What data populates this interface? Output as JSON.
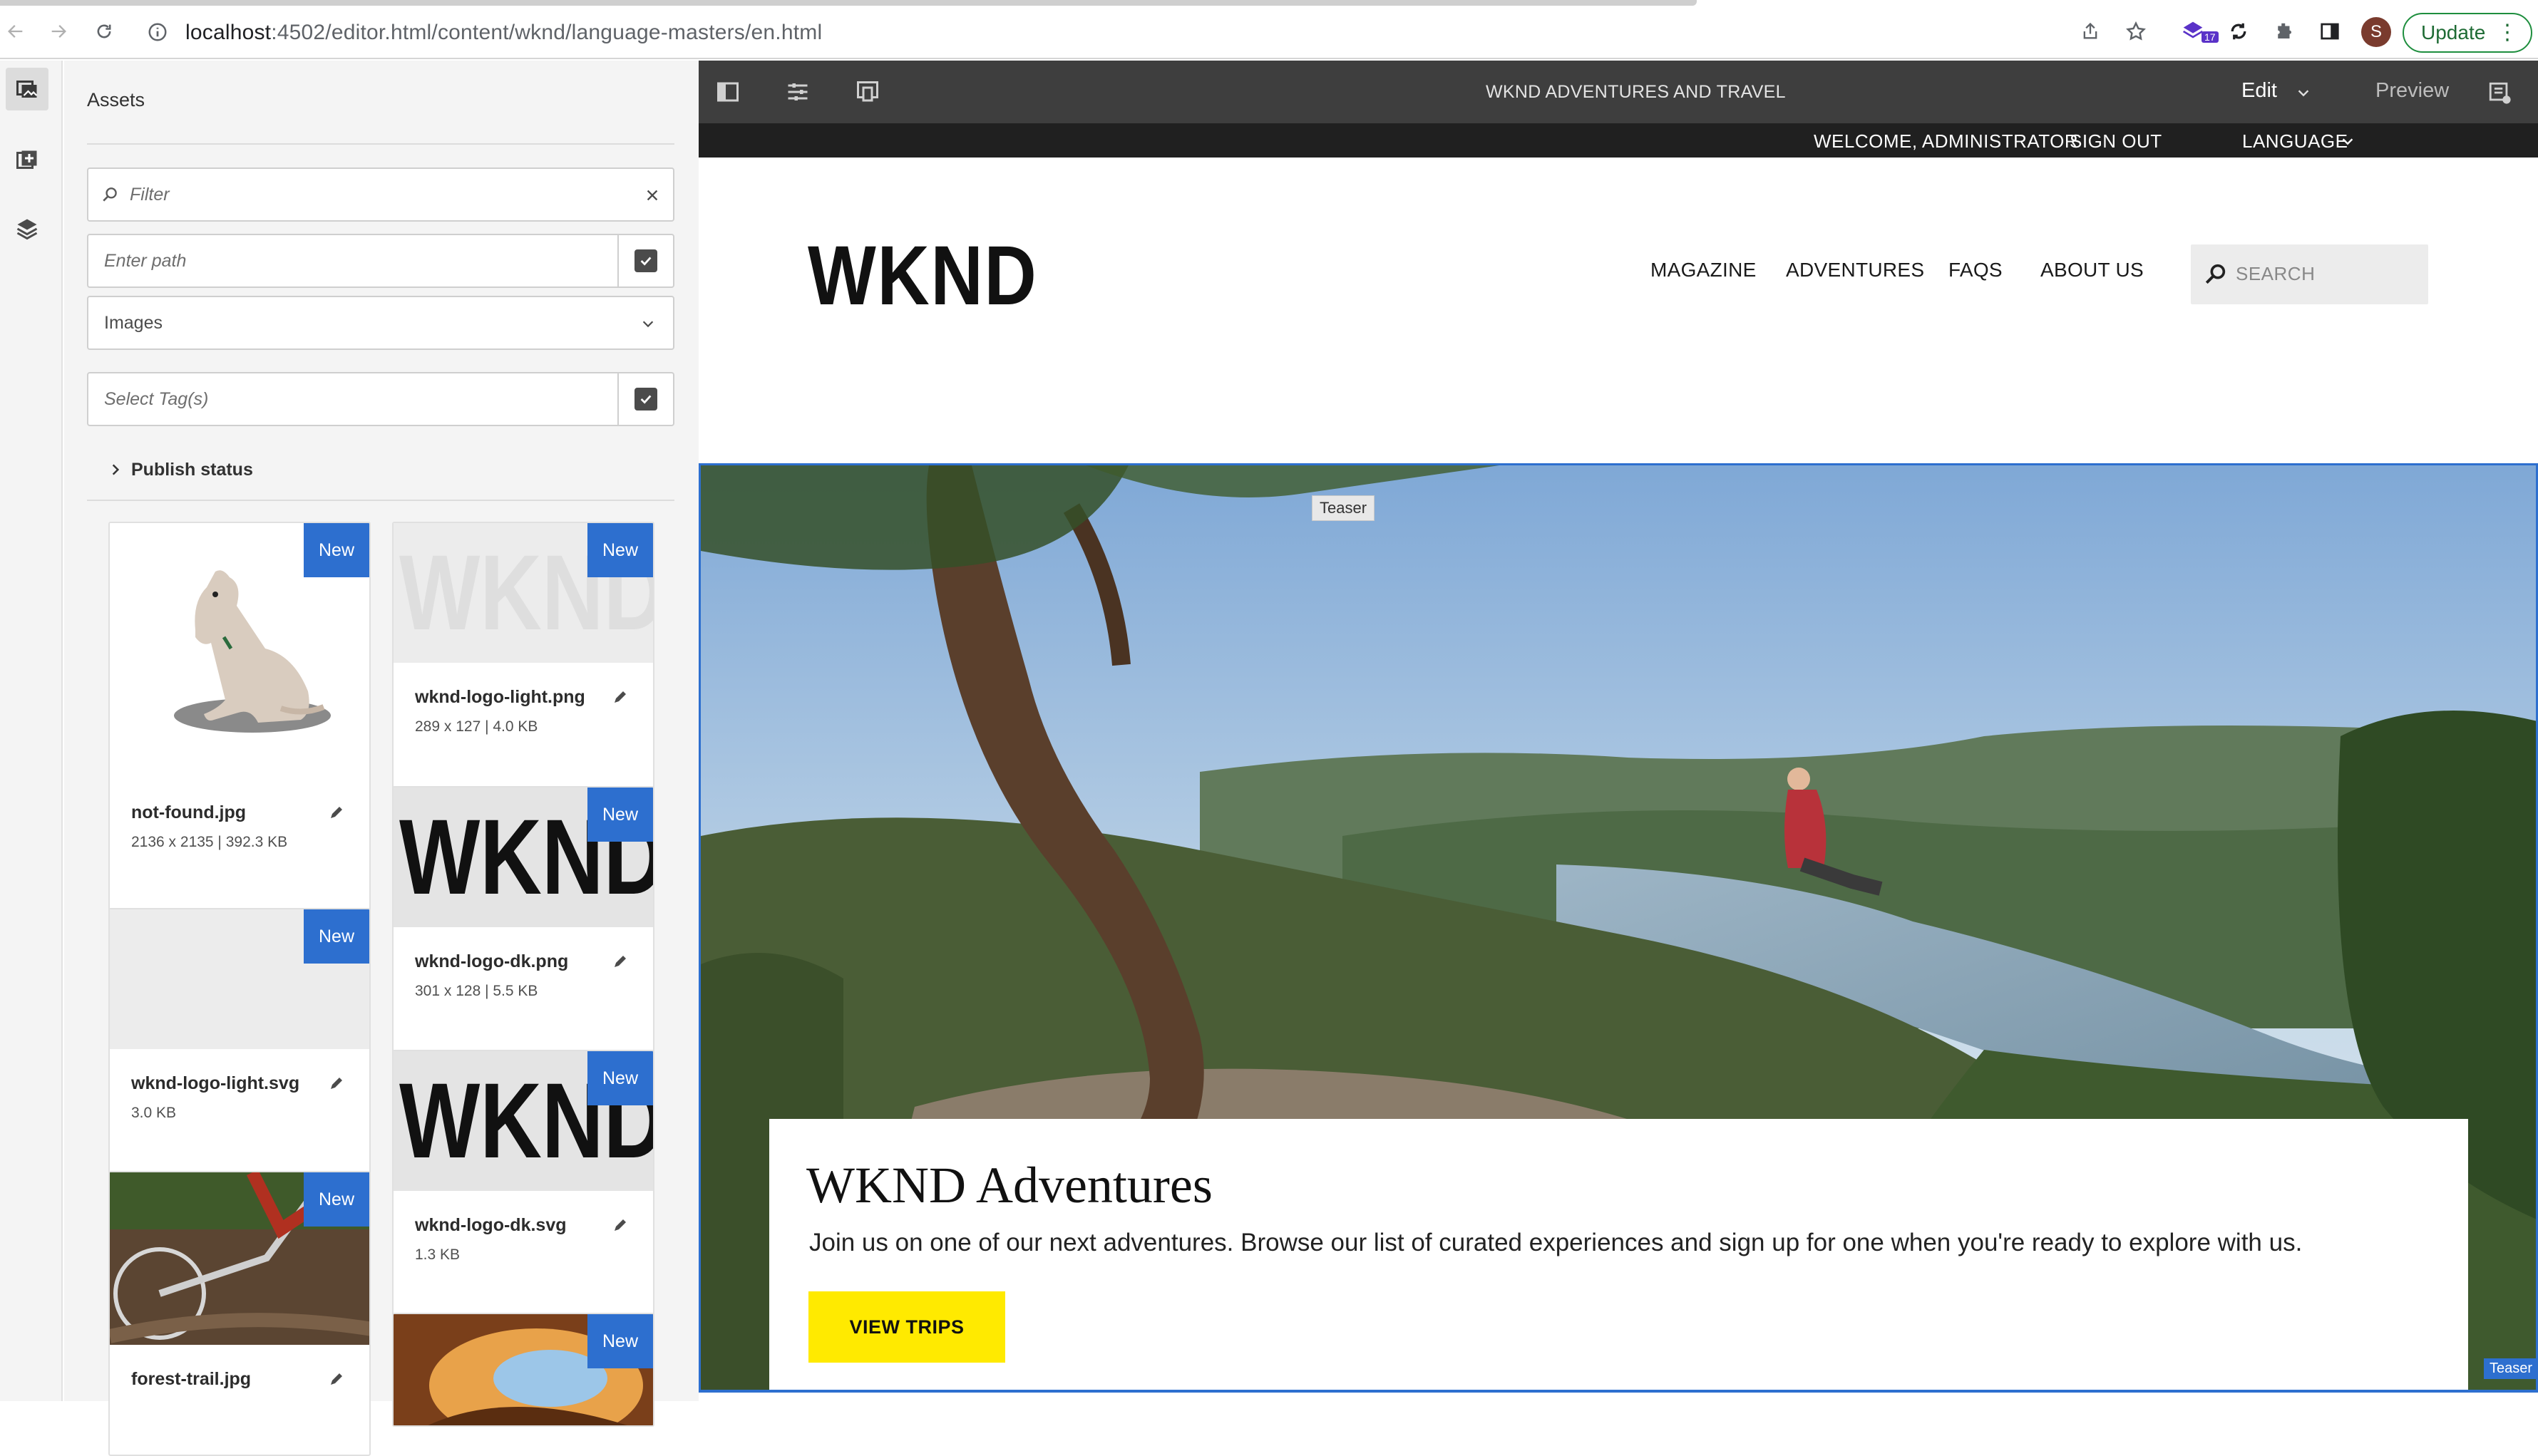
{
  "browser": {
    "url_host": "localhost",
    "url_path": ":4502/editor.html/content/wknd/language-masters/en.html",
    "extension_badge": "17",
    "profile_initial": "S",
    "update_label": "Update"
  },
  "assets_panel": {
    "title": "Assets",
    "filter_placeholder": "Filter",
    "path_placeholder": "Enter path",
    "type_select_value": "Images",
    "tags_placeholder": "Select Tag(s)",
    "publish_status_label": "Publish status",
    "badge_label": "New",
    "assets": [
      {
        "name": "not-found.jpg",
        "meta": "2136 x 2135 | 392.3 KB"
      },
      {
        "name": "wknd-logo-light.png",
        "meta": "289 x 127 | 4.0 KB"
      },
      {
        "name": "wknd-logo-dk.png",
        "meta": "301 x 128 | 5.5 KB"
      },
      {
        "name": "wknd-logo-light.svg",
        "meta": "3.0 KB"
      },
      {
        "name": "wknd-logo-dk.svg",
        "meta": "1.3 KB"
      },
      {
        "name": "forest-trail.jpg",
        "meta": ""
      },
      {
        "name": "",
        "meta": ""
      }
    ],
    "thumb_logo_text": "WKND"
  },
  "editor_bar": {
    "page_title": "WKND ADVENTURES AND TRAVEL",
    "mode": "Edit",
    "preview_label": "Preview"
  },
  "site": {
    "welcome": "WELCOME, ADMINISTRATOR",
    "sign_out": "SIGN OUT",
    "language": "LANGUAGE",
    "logo": "WKND",
    "nav": [
      "MAGAZINE",
      "ADVENTURES",
      "FAQS",
      "ABOUT US"
    ],
    "search_placeholder": "SEARCH",
    "teaser_label": "Teaser",
    "teaser_title": "WKND Adventures",
    "teaser_text": "Join us on one of our next adventures. Browse our list of curated experiences and sign up for one when you're ready to explore with us.",
    "cta_label": "VIEW TRIPS",
    "teaser_tag": "Teaser"
  },
  "colors": {
    "accent_blue": "#2d6fcf",
    "cta_yellow": "#ffea00",
    "editor_bar": "#3e3e3e",
    "util_bar": "#202020"
  }
}
